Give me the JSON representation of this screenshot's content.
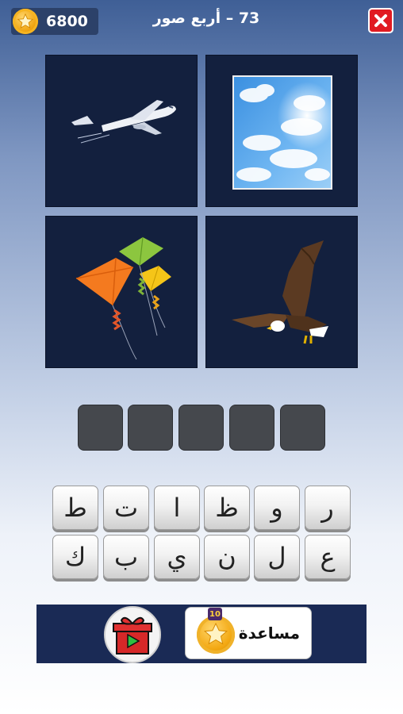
{
  "header": {
    "coins": "6800",
    "title": "73 – أربع صور",
    "close_icon": "close-icon"
  },
  "tiles": [
    {
      "name": "airplane-image"
    },
    {
      "name": "sky-image"
    },
    {
      "name": "kites-image"
    },
    {
      "name": "eagle-image"
    }
  ],
  "answer": {
    "slots": 5
  },
  "keyboard": {
    "row1": [
      "ط",
      "ت",
      "ا",
      "ظ",
      "و",
      "ر"
    ],
    "row2": [
      "ك",
      "ب",
      "ي",
      "ن",
      "ل",
      "ع"
    ]
  },
  "bottom": {
    "help_label": "مساعدة",
    "help_cost": "10",
    "gift_icon": "gift-video-icon"
  },
  "colors": {
    "tile_bg": "#13203e",
    "slot_bg": "#45484d",
    "close_red": "#e11b22",
    "coin_gold": "#f3a812"
  }
}
